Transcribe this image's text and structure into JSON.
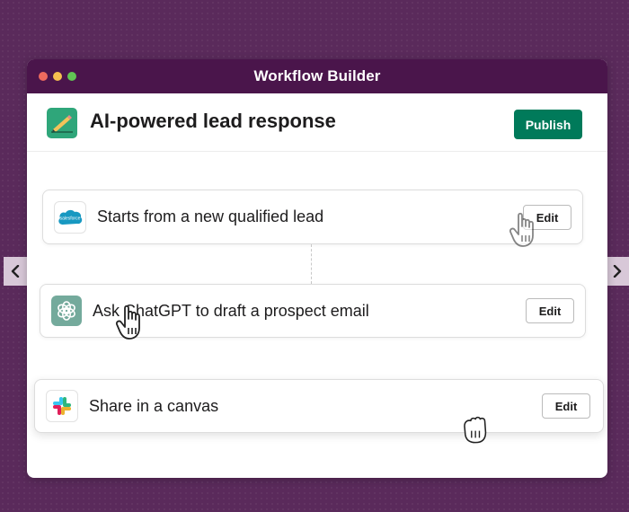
{
  "window": {
    "title": "Workflow Builder",
    "dots": [
      "#ed6a5e",
      "#f5bf4f",
      "#61c554"
    ]
  },
  "header": {
    "icon": "pencil-note-icon",
    "title": "AI-powered lead response",
    "publish_label": "Publish",
    "accent": "#007a5a"
  },
  "steps": [
    {
      "icon": "salesforce-icon",
      "label": "Starts from a new qualified lead",
      "edit_label": "Edit"
    },
    {
      "icon": "chatgpt-icon",
      "label": "Ask ChatGPT to draft a prospect email",
      "edit_label": "Edit"
    },
    {
      "icon": "slack-icon",
      "label": "Share in a canvas",
      "edit_label": "Edit"
    }
  ],
  "icons": {
    "salesforce_text": "salesforce"
  },
  "nav": {
    "left_icon": "chevron-left-icon",
    "right_icon": "chevron-right-icon"
  },
  "cursors": [
    "grab-hand-icon",
    "grab-hand-icon",
    "grab-hand-icon"
  ]
}
